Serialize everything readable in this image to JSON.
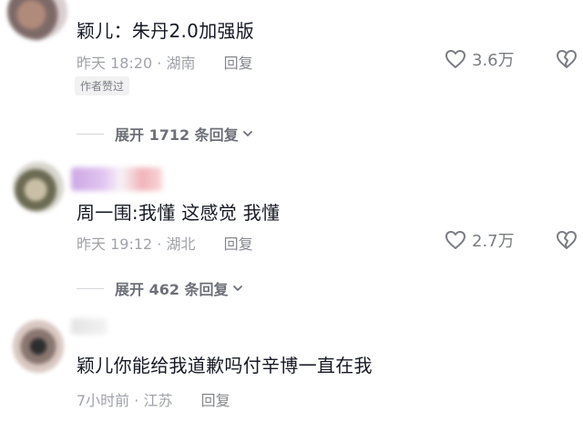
{
  "comments": [
    {
      "author": "颖儿",
      "text": "颖儿：朱丹2.0加强版",
      "time": "昨天 18:20",
      "location": "湖南",
      "reply_label": "回复",
      "likes": "3.6万",
      "badge": "作者赞过",
      "expand_label": "展开 1712 条回复"
    },
    {
      "author": "周一围",
      "text": "周一围:我懂   这感觉   我懂",
      "time": "昨天 19:12",
      "location": "湖北",
      "reply_label": "回复",
      "likes": "2.7万",
      "expand_label": "展开 462 条回复"
    },
    {
      "text": "颖儿你能给我道歉吗付辛博一直在我",
      "time": "7小时前",
      "location": "江苏",
      "reply_label": "回复"
    }
  ],
  "icons": {
    "like": "heart-outline-icon",
    "dislike": "broken-heart-icon",
    "expand": "chevron-down-icon"
  },
  "colors": {
    "text": "#161823",
    "meta": "#a0a2a8",
    "icon": "#7a7c82"
  }
}
